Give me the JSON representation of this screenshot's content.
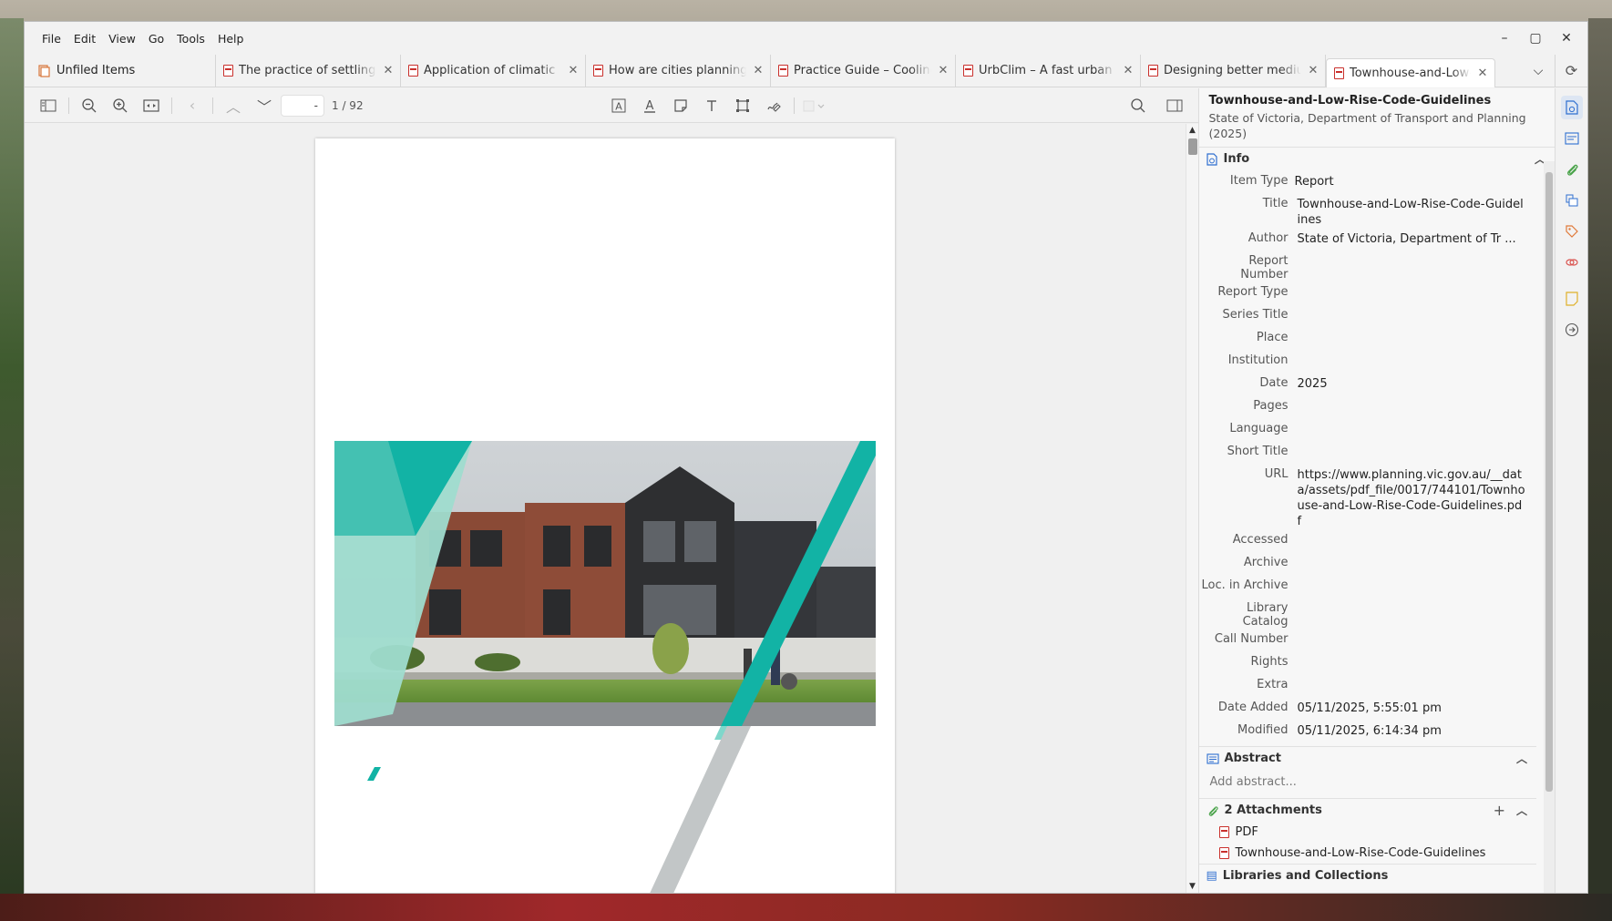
{
  "menu": [
    "File",
    "Edit",
    "View",
    "Go",
    "Tools",
    "Help"
  ],
  "window_controls": {
    "minimize": "–",
    "maximize": "▢",
    "close": "✕"
  },
  "library_tab": {
    "label": "Unfiled Items"
  },
  "tabs": [
    {
      "title": "The practice of settling"
    },
    {
      "title": "Application of climatic"
    },
    {
      "title": "How are cities planning"
    },
    {
      "title": "Practice Guide – Cooling"
    },
    {
      "title": "UrbClim – A fast urban"
    },
    {
      "title": "Designing better medium"
    },
    {
      "title": "Townhouse-and-Low-Rise"
    }
  ],
  "reader_toolbar": {
    "page_value": "-",
    "page_count": "1 / 92"
  },
  "item": {
    "title": "Townhouse-and-Low-Rise-Code-Guidelines",
    "subtitle": "State of Victoria, Department of Transport and Planning (2025)"
  },
  "info_section": {
    "label": "Info",
    "fields": [
      {
        "label": "Item Type",
        "value": "Report"
      },
      {
        "label": "Title",
        "value": "Townhouse-and-Low-Rise-Code-Guidelines"
      },
      {
        "label": "Author",
        "value": "State of Victoria, Department of Tr ..."
      },
      {
        "label": "Report Number",
        "value": ""
      },
      {
        "label": "Report Type",
        "value": ""
      },
      {
        "label": "Series Title",
        "value": ""
      },
      {
        "label": "Place",
        "value": ""
      },
      {
        "label": "Institution",
        "value": ""
      },
      {
        "label": "Date",
        "value": "2025"
      },
      {
        "label": "Pages",
        "value": ""
      },
      {
        "label": "Language",
        "value": ""
      },
      {
        "label": "Short Title",
        "value": ""
      },
      {
        "label": "URL",
        "value": "https://www.planning.vic.gov.au/__data/assets/pdf_file/0017/744101/Townhouse-and-Low-Rise-Code-Guidelines.pdf"
      },
      {
        "label": "Accessed",
        "value": ""
      },
      {
        "label": "Archive",
        "value": ""
      },
      {
        "label": "Loc. in Archive",
        "value": ""
      },
      {
        "label": "Library Catalog",
        "value": ""
      },
      {
        "label": "Call Number",
        "value": ""
      },
      {
        "label": "Rights",
        "value": ""
      },
      {
        "label": "Extra",
        "value": ""
      },
      {
        "label": "Date Added",
        "value": "05/11/2025, 5:55:01 pm"
      },
      {
        "label": "Modified",
        "value": "05/11/2025, 6:14:34 pm"
      }
    ]
  },
  "abstract_section": {
    "label": "Abstract",
    "placeholder": "Add abstract..."
  },
  "attachments_section": {
    "label": "2 Attachments",
    "items": [
      "PDF",
      "Townhouse-and-Low-Rise-Code-Guidelines"
    ]
  },
  "libraries_section": {
    "label": "Libraries and Collections"
  },
  "colors": {
    "accent": "#2f6fd0",
    "teal": "#12b3a5",
    "pdf_red": "#c9302c"
  }
}
